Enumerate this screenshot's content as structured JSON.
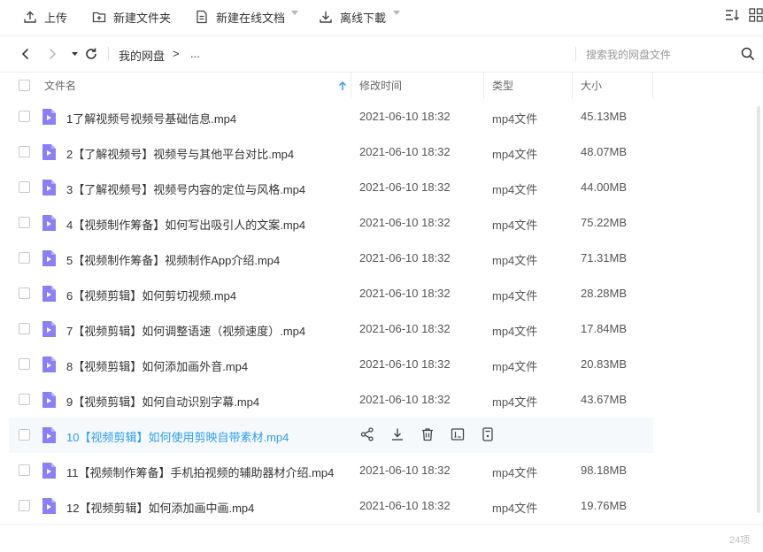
{
  "toolbar": {
    "upload_label": "上传",
    "new_folder_label": "新建文件夹",
    "new_doc_label": "新建在线文档",
    "offline_download_label": "离线下載"
  },
  "nav": {
    "breadcrumb_root": "我的网盘",
    "breadcrumb_separator": ">",
    "breadcrumb_more": "...",
    "search_placeholder": "搜索我的网盘文件"
  },
  "table": {
    "columns": {
      "name": "文件名",
      "modified": "修改时间",
      "type": "类型",
      "size": "大小"
    },
    "hover_index": 9,
    "rows": [
      {
        "name": "1了解视频号视频号基础信息.mp4",
        "modified": "2021-06-10 18:32",
        "type": "mp4文件",
        "size": "45.13MB"
      },
      {
        "name": "2【了解视频号】视频号与其他平台对比.mp4",
        "modified": "2021-06-10 18:32",
        "type": "mp4文件",
        "size": "48.07MB"
      },
      {
        "name": "3【了解视频号】视频号内容的定位与风格.mp4",
        "modified": "2021-06-10 18:32",
        "type": "mp4文件",
        "size": "44.00MB"
      },
      {
        "name": "4【视频制作筹备】如何写出吸引人的文案.mp4",
        "modified": "2021-06-10 18:32",
        "type": "mp4文件",
        "size": "75.22MB"
      },
      {
        "name": "5【视频制作筹备】视频制作App介绍.mp4",
        "modified": "2021-06-10 18:32",
        "type": "mp4文件",
        "size": "71.31MB"
      },
      {
        "name": "6【视频剪辑】如何剪切视频.mp4",
        "modified": "2021-06-10 18:32",
        "type": "mp4文件",
        "size": "28.28MB"
      },
      {
        "name": "7【视频剪辑】如何调整语速（视频速度）.mp4",
        "modified": "2021-06-10 18:32",
        "type": "mp4文件",
        "size": "17.84MB"
      },
      {
        "name": "8【视频剪辑】如何添加画外音.mp4",
        "modified": "2021-06-10 18:32",
        "type": "mp4文件",
        "size": "20.83MB"
      },
      {
        "name": "9【视频剪辑】如何自动识别字幕.mp4",
        "modified": "2021-06-10 18:32",
        "type": "mp4文件",
        "size": "43.67MB"
      },
      {
        "name": "10【视频剪辑】如何使用剪映自带素材.mp4",
        "modified": "",
        "type": "",
        "size": ""
      },
      {
        "name": "11【视频制作筹备】手机拍视频的辅助器材介绍.mp4",
        "modified": "2021-06-10 18:32",
        "type": "mp4文件",
        "size": "98.18MB"
      },
      {
        "name": "12【视频剪辑】如何添加画中画.mp4",
        "modified": "2021-06-10 18:32",
        "type": "mp4文件",
        "size": "19.76MB"
      }
    ]
  },
  "footer": {
    "page_count": "24项"
  },
  "colors": {
    "accent": "#2d9ef5",
    "file_icon": "#8b7ff5",
    "hover_row": "#f6f9fc"
  }
}
